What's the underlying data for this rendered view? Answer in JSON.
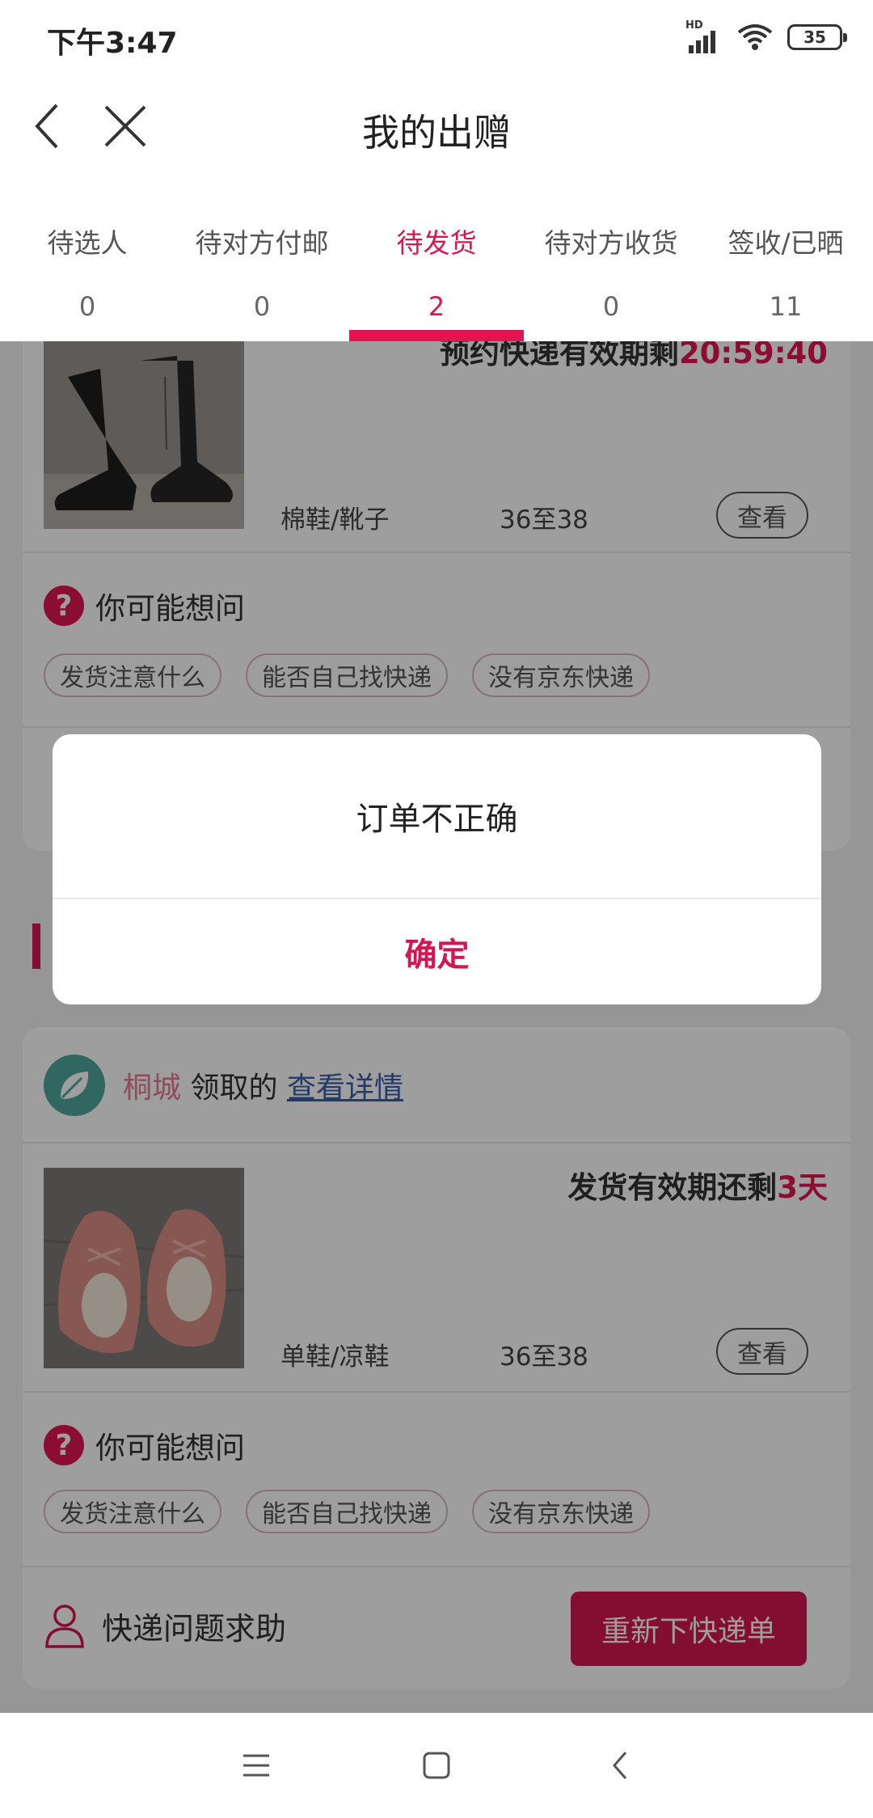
{
  "status_bar": {
    "time": "下午3:47",
    "network_label": "HD",
    "battery": "35"
  },
  "nav": {
    "title": "我的出赠",
    "back_icon": "chevron-left-icon",
    "close_icon": "close-icon"
  },
  "tabs": [
    {
      "label": "待选人",
      "count": "0",
      "active": false
    },
    {
      "label": "待对方付邮",
      "count": "0",
      "active": false
    },
    {
      "label": "待发货",
      "count": "2",
      "active": true
    },
    {
      "label": "待对方收货",
      "count": "0",
      "active": false
    },
    {
      "label": "签收/已晒",
      "count": "11",
      "active": false
    }
  ],
  "accent_color": "#e21553",
  "orders": [
    {
      "deadline_prefix": "预约快递有效期剩",
      "deadline_value": "20:59:40",
      "category": "棉鞋/靴子",
      "size": "36至38",
      "view_label": "查看",
      "faq_title": "你可能想问",
      "faq_chips": [
        "发货注意什么",
        "能否自己找快递",
        "没有京东快递"
      ]
    },
    {
      "receiver_city": "桐城",
      "receiver_suffix": "领取的",
      "detail_link": "查看详情",
      "deadline_prefix": "发货有效期还剩",
      "deadline_value": "3天",
      "category": "单鞋/凉鞋",
      "size": "36至38",
      "view_label": "查看",
      "faq_title": "你可能想问",
      "faq_chips": [
        "发货注意什么",
        "能否自己找快递",
        "没有京东快递"
      ],
      "help_text": "快递问题求助",
      "action_button": "重新下快递单"
    }
  ],
  "dialog": {
    "message": "订单不正确",
    "confirm_label": "确定"
  },
  "system_nav": [
    "menu-icon",
    "home-square-icon",
    "back-icon"
  ]
}
